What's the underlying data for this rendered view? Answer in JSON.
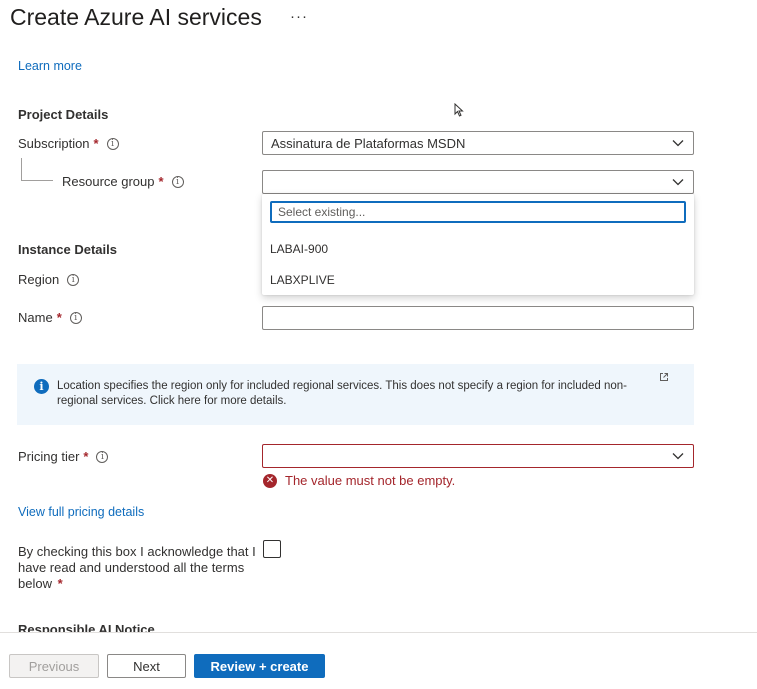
{
  "header": {
    "title": "Create Azure AI services",
    "more": "···"
  },
  "learn_more": "Learn more",
  "project_details": {
    "heading": "Project Details",
    "subscription": {
      "label": "Subscription",
      "required": "*",
      "value": "Assinatura de Plataformas MSDN"
    },
    "resource_group": {
      "label": "Resource group",
      "required": "*",
      "value": "",
      "dropdown": {
        "search_placeholder": "Select existing...",
        "options": [
          "LABAI-900",
          "LABXPLIVE"
        ]
      }
    }
  },
  "instance_details": {
    "heading": "Instance Details",
    "region": {
      "label": "Region"
    },
    "name": {
      "label": "Name",
      "required": "*",
      "value": ""
    }
  },
  "info_banner": {
    "text": "Location specifies the region only for included regional services. This does not specify a region for included non-regional services. Click here for more details."
  },
  "pricing": {
    "label": "Pricing tier",
    "required": "*",
    "value": "",
    "error": "The value must not be empty.",
    "details_link": "View full pricing details"
  },
  "acknowledge": {
    "text": "By checking this box I acknowledge that I have read and understood all the terms below",
    "required": "*",
    "checked": false
  },
  "responsible_ai": "Responsible AI Notice",
  "footer": {
    "previous": "Previous",
    "next": "Next",
    "review_create": "Review + create"
  },
  "colors": {
    "accent": "#0f6cbd",
    "error": "#a4262c",
    "info_bg": "#eff6fc"
  }
}
